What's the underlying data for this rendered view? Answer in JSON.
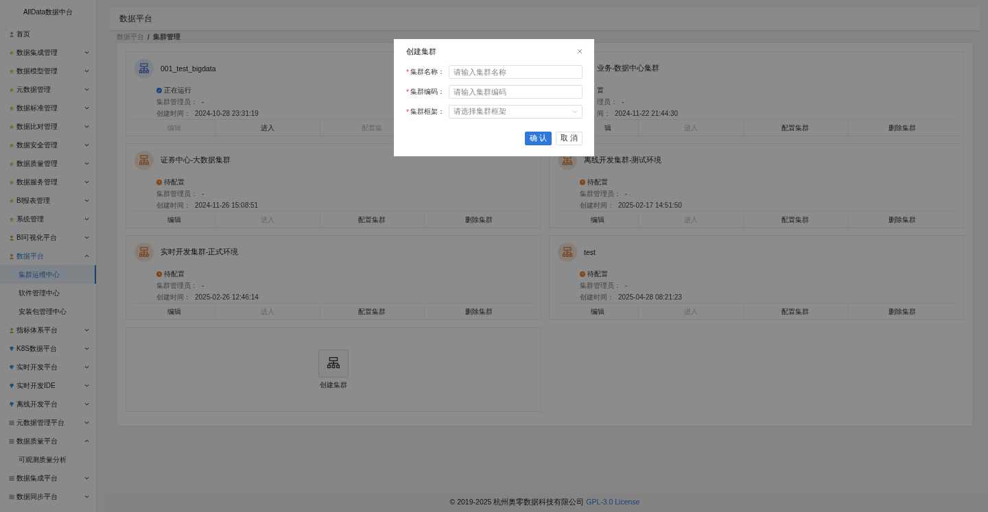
{
  "sidebar": {
    "title": "AllData数据中台",
    "items": [
      {
        "label": "首页",
        "kind": "home"
      },
      {
        "label": "数据集成管理",
        "kind": "star",
        "expanded": false
      },
      {
        "label": "数据模型管理",
        "kind": "star",
        "expanded": false
      },
      {
        "label": "元数据管理",
        "kind": "star",
        "expanded": false
      },
      {
        "label": "数据标准管理",
        "kind": "star",
        "expanded": false
      },
      {
        "label": "数据比对管理",
        "kind": "star",
        "expanded": false
      },
      {
        "label": "数据安全管理",
        "kind": "star",
        "expanded": false
      },
      {
        "label": "数据质量管理",
        "kind": "star",
        "expanded": false
      },
      {
        "label": "数据服务管理",
        "kind": "star",
        "expanded": false
      },
      {
        "label": "BI报表管理",
        "kind": "star",
        "expanded": false
      },
      {
        "label": "系统管理",
        "kind": "star",
        "expanded": false
      },
      {
        "label": "BI可视化平台",
        "kind": "person",
        "expanded": false
      },
      {
        "label": "数据平台",
        "kind": "person",
        "expanded": true,
        "children": [
          {
            "label": "集群运维中心",
            "selected": true
          },
          {
            "label": "软件管理中心",
            "selected": false
          },
          {
            "label": "安装包管理中心",
            "selected": false
          }
        ]
      },
      {
        "label": "指标体系平台",
        "kind": "person",
        "expanded": false
      },
      {
        "label": "K8S数据平台",
        "kind": "diamond",
        "expanded": false
      },
      {
        "label": "实时开发平台",
        "kind": "diamond",
        "expanded": false
      },
      {
        "label": "实时开发IDE",
        "kind": "diamond",
        "expanded": false
      },
      {
        "label": "离线开发平台",
        "kind": "diamond",
        "expanded": false
      },
      {
        "label": "元数据管理平台",
        "kind": "grid",
        "expanded": false
      },
      {
        "label": "数据质量平台",
        "kind": "grid",
        "expanded": true,
        "children": [
          {
            "label": "可观测质量分析",
            "selected": false
          }
        ]
      },
      {
        "label": "数据集成平台",
        "kind": "grid",
        "expanded": false
      },
      {
        "label": "数据同步平台",
        "kind": "grid",
        "expanded": false
      }
    ]
  },
  "page_title": "数据平台",
  "breadcrumb": {
    "items": [
      "数据平台",
      "集群管理"
    ],
    "separator": "/"
  },
  "clusters": [
    {
      "name": "001_test_bigdata",
      "covered_by_dialog": false,
      "status": {
        "text": "正在运行",
        "kind": "running"
      },
      "manager_label": "集群管理员：",
      "manager": "-",
      "created_label": "创建时间：",
      "created": "2024-10-28 23:31:19",
      "actions": [
        {
          "label": "编辑",
          "disabled": true
        },
        {
          "label": "进入",
          "disabled": false
        },
        {
          "label": "配置集",
          "disabled": true
        }
      ]
    },
    {
      "name": "业务-数据中心集群",
      "covered_by_dialog": true,
      "status": {
        "text": "置"
      },
      "manager_label": "理员：",
      "manager": "-",
      "created_label": "间：",
      "created": "2024-11-22 21:44:30",
      "actions": [
        {
          "label": "辑",
          "disabled": false
        },
        {
          "label": "进入",
          "disabled": true
        },
        {
          "label": "配置集群",
          "disabled": false
        },
        {
          "label": "删除集群",
          "disabled": false
        }
      ]
    },
    {
      "name": "证券中心-大数据集群",
      "covered_by_dialog": false,
      "status": {
        "text": "待配置",
        "kind": "pending"
      },
      "manager_label": "集群管理员：",
      "manager": "-",
      "created_label": "创建时间：",
      "created": "2024-11-26 15:08:51",
      "actions": [
        {
          "label": "编辑",
          "disabled": false
        },
        {
          "label": "进入",
          "disabled": true
        },
        {
          "label": "配置集群",
          "disabled": false
        },
        {
          "label": "删除集群",
          "disabled": false
        }
      ]
    },
    {
      "name": "离线开发集群-测试环境",
      "covered_by_dialog": false,
      "status": {
        "text": "待配置",
        "kind": "pending"
      },
      "manager_label": "集群管理员：",
      "manager": "-",
      "created_label": "创建时间：",
      "created": "2025-02-17 14:51:50",
      "actions": [
        {
          "label": "编辑",
          "disabled": false
        },
        {
          "label": "进入",
          "disabled": true
        },
        {
          "label": "配置集群",
          "disabled": false
        },
        {
          "label": "删除集群",
          "disabled": false
        }
      ]
    },
    {
      "name": "实时开发集群-正式环境",
      "covered_by_dialog": false,
      "status": {
        "text": "待配置",
        "kind": "pending"
      },
      "manager_label": "集群管理员：",
      "manager": "-",
      "created_label": "创建时间：",
      "created": "2025-02-26 12:46:14",
      "actions": [
        {
          "label": "编辑",
          "disabled": false
        },
        {
          "label": "进入",
          "disabled": true
        },
        {
          "label": "配置集群",
          "disabled": false
        },
        {
          "label": "删除集群",
          "disabled": false
        }
      ]
    },
    {
      "name": "test",
      "covered_by_dialog": false,
      "status": {
        "text": "待配置",
        "kind": "pending"
      },
      "manager_label": "集群管理员：",
      "manager": "-",
      "created_label": "创建时间：",
      "created": "2025-04-28 08:21:23",
      "actions": [
        {
          "label": "编辑",
          "disabled": false
        },
        {
          "label": "进入",
          "disabled": true
        },
        {
          "label": "配置集群",
          "disabled": false
        },
        {
          "label": "删除集群",
          "disabled": false
        }
      ]
    }
  ],
  "create_tile": {
    "label": "创建集群"
  },
  "footer": {
    "text": "© 2019-2025 杭州奥零数据科技有限公司",
    "link": "GPL-3.0 License"
  },
  "dialog": {
    "title": "创建集群",
    "fields": [
      {
        "label": "集群名称：",
        "required_mark": "*",
        "kind": "input",
        "placeholder": "请输入集群名称"
      },
      {
        "label": "集群编码：",
        "required_mark": "*",
        "kind": "input",
        "placeholder": "请输入集群编码"
      },
      {
        "label": "集群框架：",
        "required_mark": "*",
        "kind": "select",
        "placeholder": "请选择集群框架"
      }
    ],
    "buttons": [
      {
        "label": "确 认",
        "kind": "primary"
      },
      {
        "label": "取 消",
        "kind": "default"
      }
    ]
  }
}
